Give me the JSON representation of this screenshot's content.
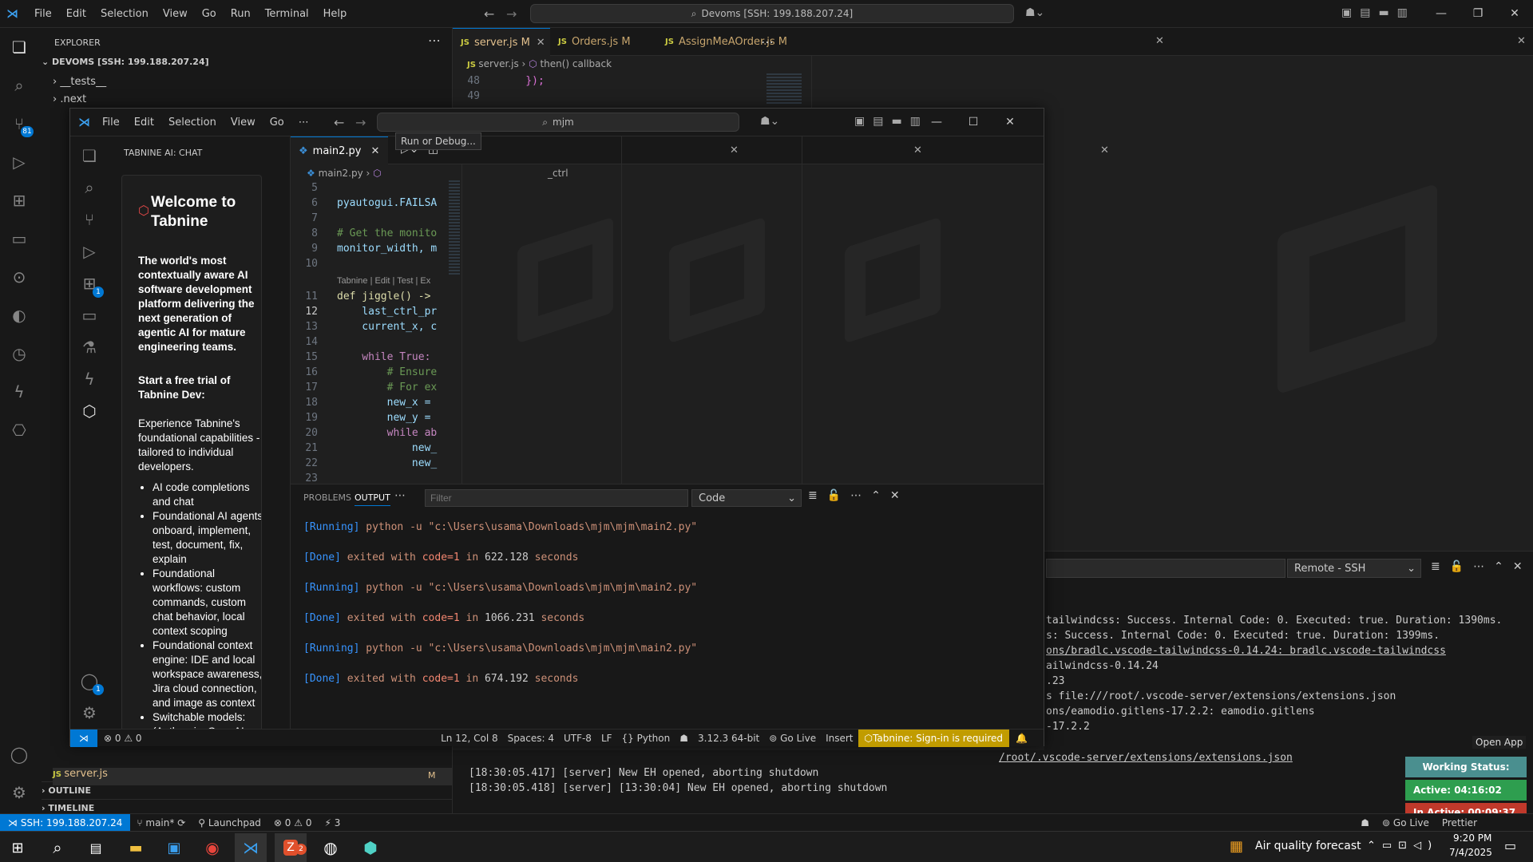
{
  "back": {
    "menu": [
      "File",
      "Edit",
      "Selection",
      "View",
      "Go",
      "Run",
      "Terminal",
      "Help"
    ],
    "command_center": "Devoms [SSH: 199.188.207.24]",
    "explorer_title": "EXPLORER",
    "root_folder": "DEVOMS [SSH: 199.188.207.24]",
    "tree_top": [
      "__tests__",
      ".next"
    ],
    "tree_bottom": {
      "file": "server.js",
      "status": "M"
    },
    "outline": "OUTLINE",
    "timeline": "TIMELINE",
    "tabs": [
      {
        "label": "server.js",
        "status": "M"
      },
      {
        "label": "Orders.js",
        "status": "M"
      },
      {
        "label": "AssignMeAOrder.js",
        "status": "M"
      }
    ],
    "breadcrumb": {
      "file": "server.js",
      "symbol": "then() callback"
    },
    "code": [
      {
        "n": "48",
        "t": "    });"
      },
      {
        "n": "49",
        "t": ""
      }
    ],
    "source_control_badge": "81",
    "output_channel": "Remote - SSH",
    "output_lines": [
      "tailwindcss: Success. Internal Code: 0. Executed: true. Duration: 1390ms.",
      "s: Success. Internal Code: 0. Executed: true. Duration: 1399ms.",
      "ons/bradlc.vscode-tailwindcss-0.14.24: bradlc.vscode-tailwindcss",
      "ailwindcss-0.14.24",
      ".23",
      "s file:///root/.vscode-server/extensions/extensions.json",
      "ons/eamodio.gitlens-17.2.2: eamodio.gitlens",
      "-17.2.2"
    ],
    "output_tail": [
      "/root/.vscode-server/extensions/extensions.json",
      "[18:30:05.417] [server] New EH opened, aborting shutdown",
      "[18:30:05.418] [server] [13:30:04] New EH opened, aborting shutdown"
    ],
    "status": {
      "remote": "SSH: 199.188.207.24",
      "branch": "main*",
      "launchpad": "Launchpad",
      "errors": "0",
      "warnings": "0",
      "ports": "3",
      "golive": "Go Live",
      "prettier": "Prettier"
    },
    "open_app": "Open App",
    "work_status": {
      "label": "Working Status: Active",
      "active": "Active: 04:16:02",
      "inactive": "In Active: 00:09:37",
      "colors": {
        "status": "#4a8f8f",
        "active": "#2e9e4f",
        "inactive": "#c0392b"
      }
    }
  },
  "front": {
    "menu": [
      "File",
      "Edit",
      "Selection",
      "View",
      "Go"
    ],
    "search": "mjm",
    "tabnine": {
      "header": "TABNINE AI: CHAT",
      "welcome": "Welcome to Tabnine",
      "intro": "The world's most contextually aware AI software development platform delivering the next generation of agentic AI for mature engineering teams.",
      "trial": "Start a free trial of Tabnine Dev:",
      "desc": "Experience Tabnine's foundational capabilities - tailored to individual developers.",
      "bullets": [
        "AI code completions and chat",
        "Foundational AI agents: onboard, implement, test, document, fix, explain",
        "Foundational workflows: custom commands, custom chat behavior, local context scoping",
        "Foundational context engine: IDE and local workspace awareness, Jira cloud connection, and image as context",
        "Switchable models: (Anthropic, OpenAI"
      ]
    },
    "tab": "main2.py",
    "breadcrumb": {
      "file": "main2.py",
      "symbol": "_ctrl"
    },
    "tooltip": "Run or Debug...",
    "codelens": "Tabnine | Edit | Test | Ex",
    "code": [
      {
        "n": "5",
        "t": ""
      },
      {
        "n": "6",
        "t": "pyautogui.FAILSA"
      },
      {
        "n": "7",
        "t": ""
      },
      {
        "n": "8",
        "t": "# Get the monito"
      },
      {
        "n": "9",
        "t": "monitor_width, m"
      },
      {
        "n": "10",
        "t": ""
      },
      {
        "n": "11",
        "t": "def jiggle() ->"
      },
      {
        "n": "12",
        "t": "    last_ctrl_pr"
      },
      {
        "n": "13",
        "t": "    current_x, c"
      },
      {
        "n": "14",
        "t": ""
      },
      {
        "n": "15",
        "t": "    while True:"
      },
      {
        "n": "16",
        "t": "        # Ensure"
      },
      {
        "n": "17",
        "t": "        # For ex"
      },
      {
        "n": "18",
        "t": "        new_x ="
      },
      {
        "n": "19",
        "t": "        new_y ="
      },
      {
        "n": "20",
        "t": "        while ab"
      },
      {
        "n": "21",
        "t": "            new_"
      },
      {
        "n": "22",
        "t": "            new_"
      },
      {
        "n": "23",
        "t": ""
      }
    ],
    "panel_tabs": [
      "PROBLEMS",
      "OUTPUT"
    ],
    "filter_placeholder": "Filter",
    "output_channel": "Code",
    "output": [
      {
        "tag": "[Running]",
        "text": " python -u \"c:\\Users\\usama\\Downloads\\mjm\\mjm\\main2.py\""
      },
      {
        "tag": "[Done]",
        "text": " exited with ",
        "code": "code=1",
        "mid": " in ",
        "num": "622.128",
        "end": " seconds"
      },
      {
        "tag": "[Running]",
        "text": " python -u \"c:\\Users\\usama\\Downloads\\mjm\\mjm\\main2.py\""
      },
      {
        "tag": "[Done]",
        "text": " exited with ",
        "code": "code=1",
        "mid": " in ",
        "num": "1066.231",
        "end": " seconds"
      },
      {
        "tag": "[Running]",
        "text": " python -u \"c:\\Users\\usama\\Downloads\\mjm\\mjm\\main2.py\""
      },
      {
        "tag": "[Done]",
        "text": " exited with ",
        "code": "code=1",
        "mid": " in ",
        "num": "674.192",
        "end": " seconds"
      }
    ],
    "ext_badge": "1",
    "account_badge": "1",
    "status": {
      "errors": "0",
      "warnings": "0",
      "position": "Ln 12, Col 8",
      "spaces": "Spaces: 4",
      "encoding": "UTF-8",
      "eol": "LF",
      "language": "Python",
      "version": "3.12.3 64-bit",
      "golive": "Go Live",
      "insert": "Insert",
      "tabnine": "Tabnine: Sign-in is required"
    }
  },
  "taskbar": {
    "weather": "Air quality forecast",
    "time": "9:20 PM",
    "date": "7/4/2025",
    "zoom_badge": "2"
  }
}
